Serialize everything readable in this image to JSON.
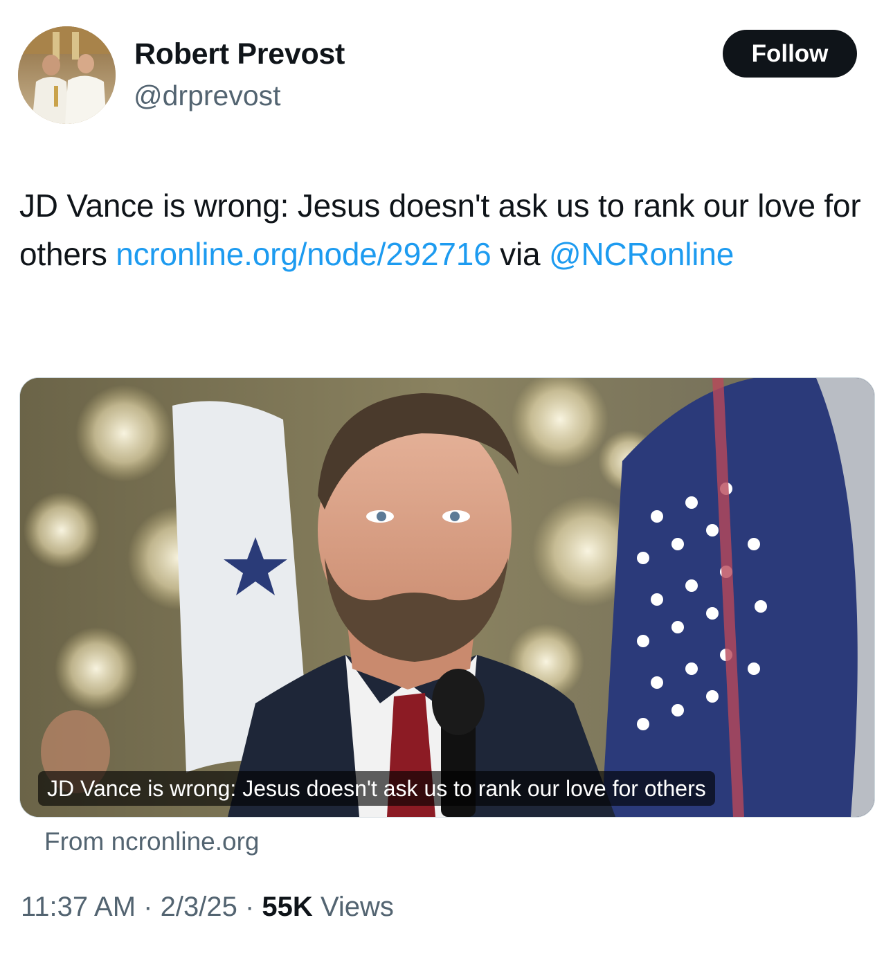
{
  "author": {
    "display_name": "Robert Prevost",
    "handle": "@drprevost"
  },
  "follow_button": {
    "label": "Follow"
  },
  "tweet": {
    "text_prefix": "JD Vance is wrong: Jesus doesn't ask us to rank our love for others ",
    "link_text": "ncronline.org/node/292716",
    "text_mid": " via ",
    "mention": "@NCRonline"
  },
  "card": {
    "caption": "JD Vance is wrong: Jesus doesn't ask us to rank our love for others",
    "source": "From ncronline.org"
  },
  "meta": {
    "time": "11:37 AM",
    "separator": "·",
    "date": "2/3/25",
    "views_count": "55K",
    "views_label": "Views"
  },
  "colors": {
    "text": "#0f1419",
    "secondary": "#536471",
    "link": "#1d9bf0",
    "follow_bg": "#0f1419"
  }
}
